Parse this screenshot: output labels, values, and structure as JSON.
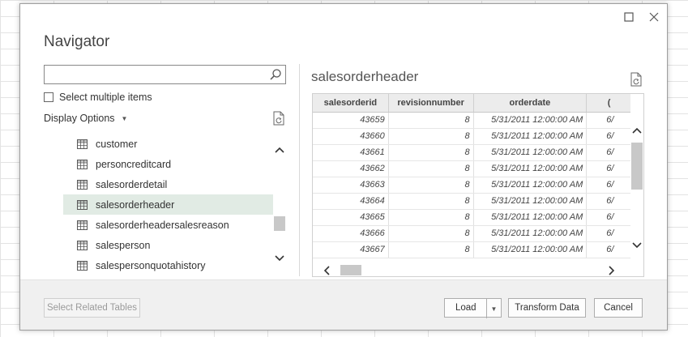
{
  "window": {
    "title": "Navigator",
    "maximize_icon": "maximize-icon",
    "close_icon": "close-icon"
  },
  "left_panel": {
    "search": {
      "value": "",
      "placeholder": "",
      "icon": "search-icon"
    },
    "select_multiple_label": "Select multiple items",
    "select_multiple_checked": false,
    "display_options_label": "Display Options",
    "display_options_icon": "chevron-down-icon",
    "refresh_icon": "refresh-document-icon",
    "items": [
      {
        "label": "customer",
        "selected": false
      },
      {
        "label": "personcreditcard",
        "selected": false
      },
      {
        "label": "salesorderdetail",
        "selected": false
      },
      {
        "label": "salesorderheader",
        "selected": true
      },
      {
        "label": "salesorderheadersalesreason",
        "selected": false
      },
      {
        "label": "salesperson",
        "selected": false
      },
      {
        "label": "salespersonquotahistory",
        "selected": false
      }
    ]
  },
  "preview": {
    "title": "salesorderheader",
    "refresh_icon": "refresh-document-icon",
    "columns": [
      "salesorderid",
      "revisionnumber",
      "orderdate",
      "("
    ],
    "rows": [
      [
        "43659",
        "8",
        "5/31/2011 12:00:00 AM",
        "6/"
      ],
      [
        "43660",
        "8",
        "5/31/2011 12:00:00 AM",
        "6/"
      ],
      [
        "43661",
        "8",
        "5/31/2011 12:00:00 AM",
        "6/"
      ],
      [
        "43662",
        "8",
        "5/31/2011 12:00:00 AM",
        "6/"
      ],
      [
        "43663",
        "8",
        "5/31/2011 12:00:00 AM",
        "6/"
      ],
      [
        "43664",
        "8",
        "5/31/2011 12:00:00 AM",
        "6/"
      ],
      [
        "43665",
        "8",
        "5/31/2011 12:00:00 AM",
        "6/"
      ],
      [
        "43666",
        "8",
        "5/31/2011 12:00:00 AM",
        "6/"
      ],
      [
        "43667",
        "8",
        "5/31/2011 12:00:00 AM",
        "6/"
      ]
    ]
  },
  "footer": {
    "select_related_label": "Select Related Tables",
    "load_label": "Load",
    "load_menu_icon": "chevron-down-icon",
    "transform_label": "Transform Data",
    "cancel_label": "Cancel"
  }
}
